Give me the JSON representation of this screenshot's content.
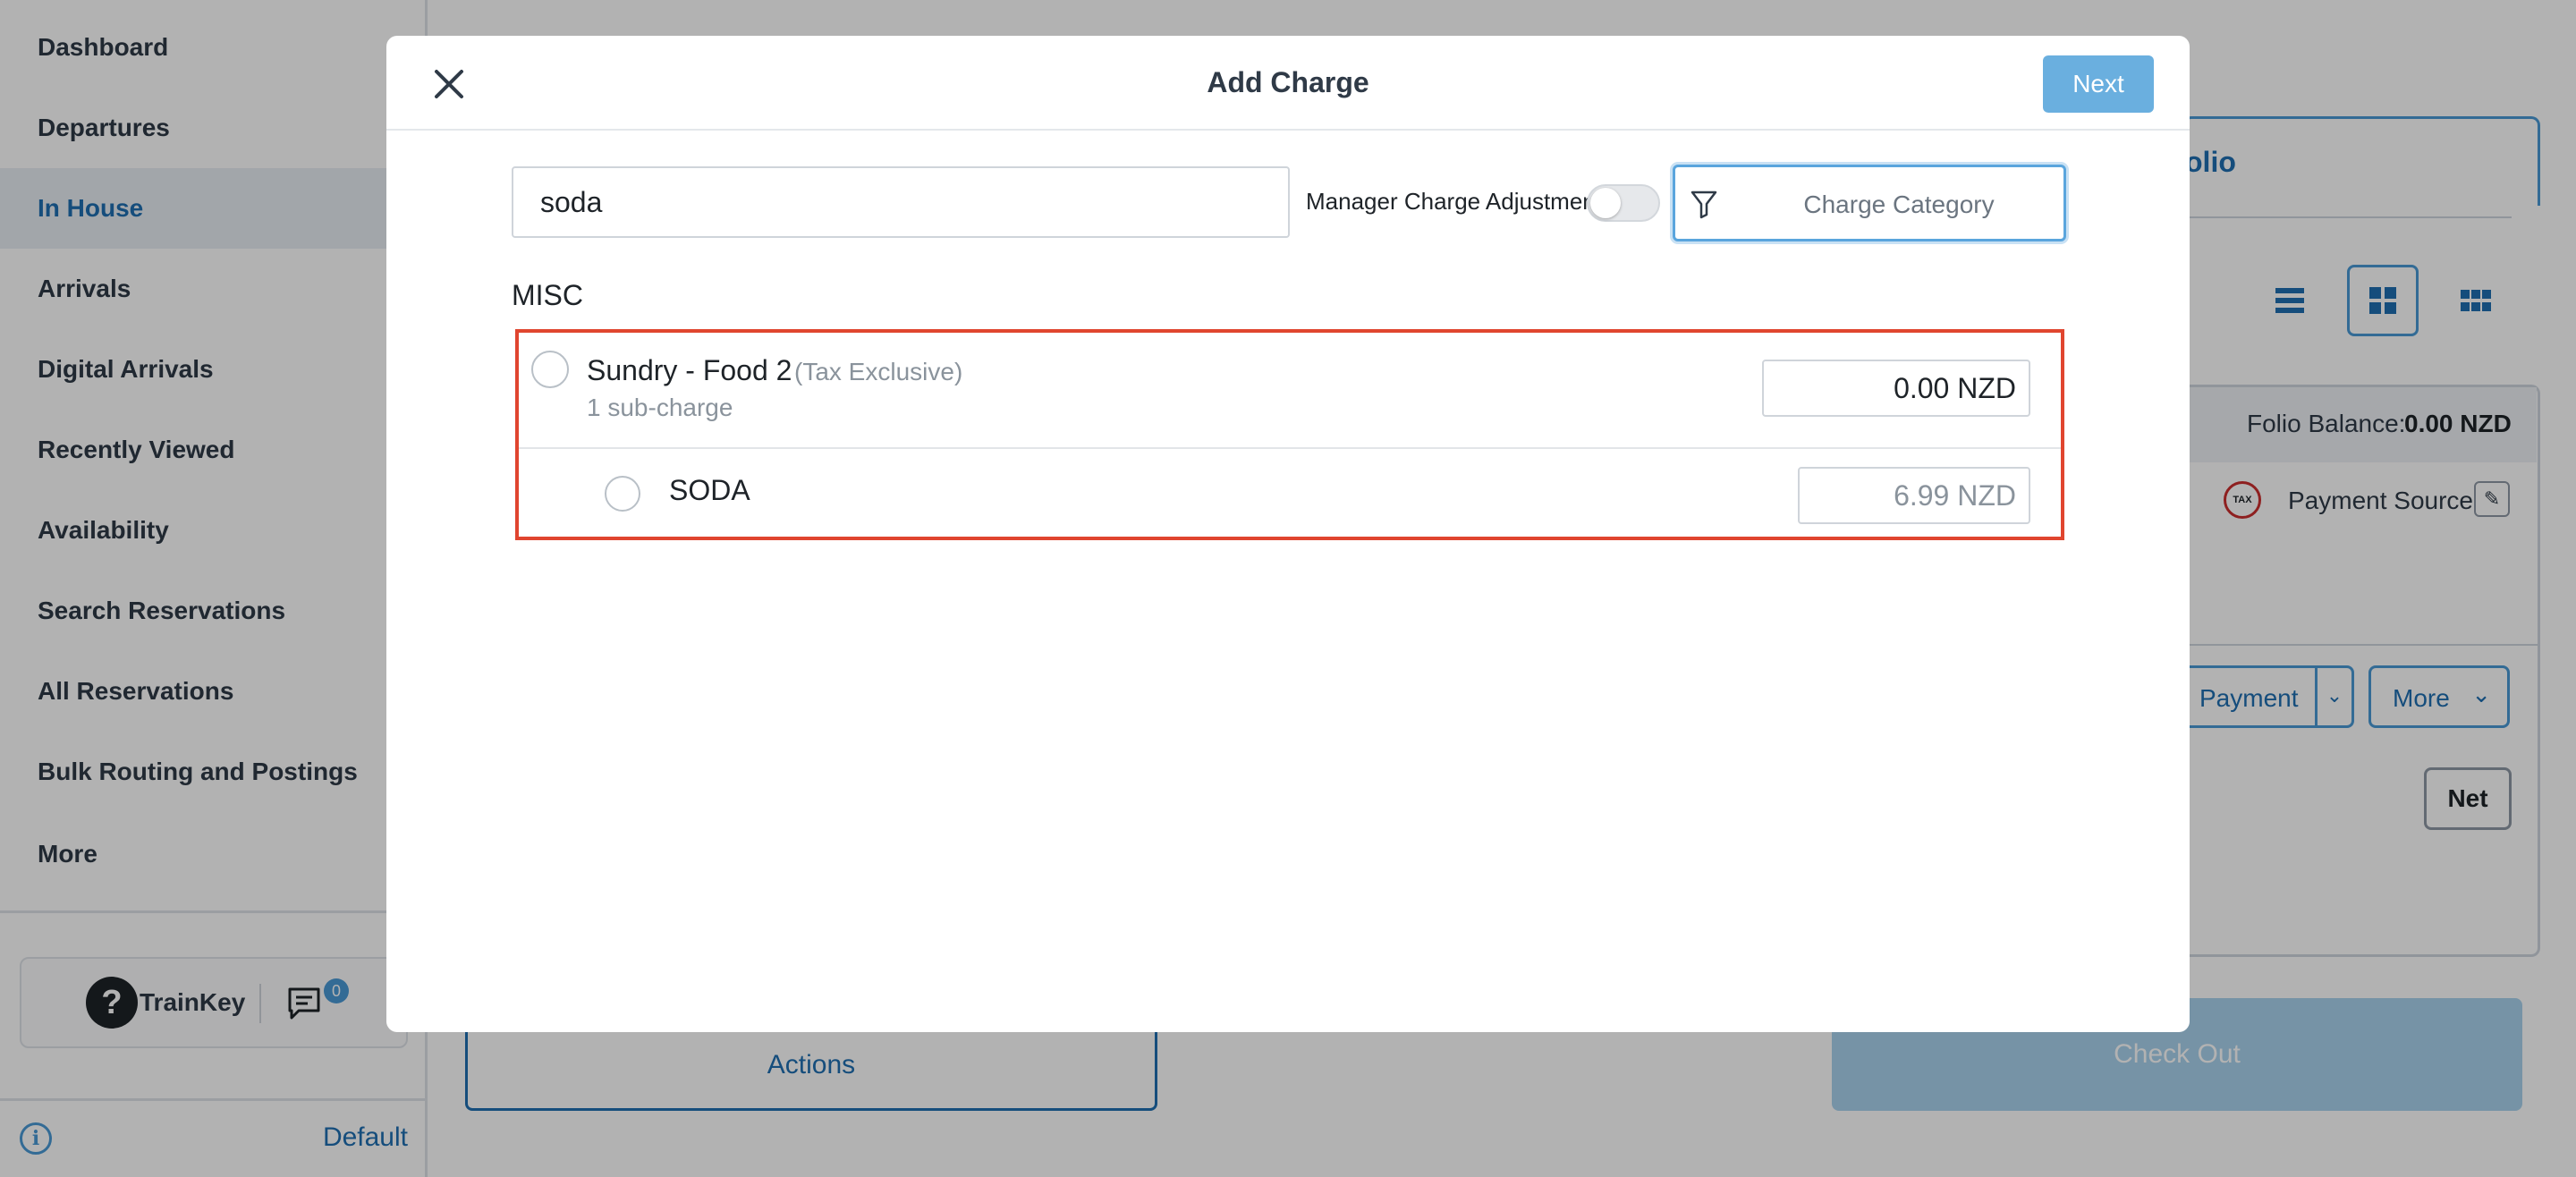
{
  "sidebar": {
    "items": [
      {
        "label": "Dashboard"
      },
      {
        "label": "Departures"
      },
      {
        "label": "In House"
      },
      {
        "label": "Arrivals"
      },
      {
        "label": "Digital Arrivals"
      },
      {
        "label": "Recently Viewed"
      },
      {
        "label": "Availability"
      },
      {
        "label": "Search Reservations"
      },
      {
        "label": "All Reservations"
      },
      {
        "label": "Bulk Routing and Postings"
      },
      {
        "label": "More"
      }
    ],
    "active_item": "In House",
    "help_label": "TrainKey",
    "chat_count": "0",
    "footer_link": "Default"
  },
  "background": {
    "folio_tab_label": "olio",
    "folio_balance_label": "Folio Balance:",
    "folio_balance_value": "0.00 NZD",
    "tax_icon_text": "TAX",
    "payment_source_label": "Payment Source",
    "payment_button_label": "Payment",
    "more_button_label": "More",
    "net_button_label": "Net",
    "actions_button_label": "Actions",
    "checkout_button_label": "Check Out"
  },
  "modal": {
    "title": "Add Charge",
    "next_label": "Next",
    "search_value": "soda",
    "manager_adjustment_label": "Manager Charge Adjustment",
    "manager_adjustment_on": false,
    "category_placeholder": "Charge Category",
    "group_label": "MISC",
    "charge": {
      "name": "Sundry - Food 2",
      "tax_note": "(Tax Exclusive)",
      "subcharge_count": "1 sub-charge",
      "amount": "0.00 NZD"
    },
    "subcharge": {
      "name": "SODA",
      "amount": "6.99 NZD"
    }
  },
  "colors": {
    "accent": "#4a9ad6",
    "highlight_border": "#e0452f",
    "next_button": "#6aafdf"
  }
}
